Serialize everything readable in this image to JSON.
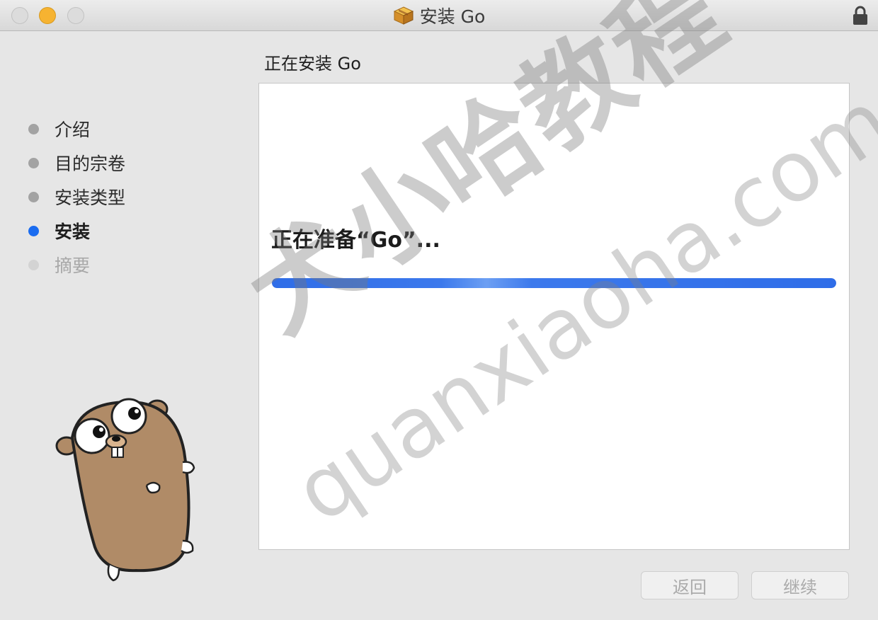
{
  "window": {
    "title": "安装 Go"
  },
  "sidebar": {
    "steps": [
      {
        "label": "介绍",
        "state": "done"
      },
      {
        "label": "目的宗卷",
        "state": "done"
      },
      {
        "label": "安装类型",
        "state": "done"
      },
      {
        "label": "安装",
        "state": "active"
      },
      {
        "label": "摘要",
        "state": "pending"
      }
    ]
  },
  "main": {
    "heading": "正在安装 Go",
    "status": "正在准备“Go”...",
    "progress": 1.0
  },
  "buttons": {
    "back": "返回",
    "continue": "继续"
  },
  "watermark": {
    "chinese": "犬小哈教程",
    "url": "quanxiaoha.com"
  },
  "colors": {
    "accent": "#1a6cf0",
    "progress": "#2f6de8",
    "minimize": "#f6b331"
  },
  "icons": [
    "package-icon",
    "lock-icon",
    "gopher-mascot"
  ]
}
